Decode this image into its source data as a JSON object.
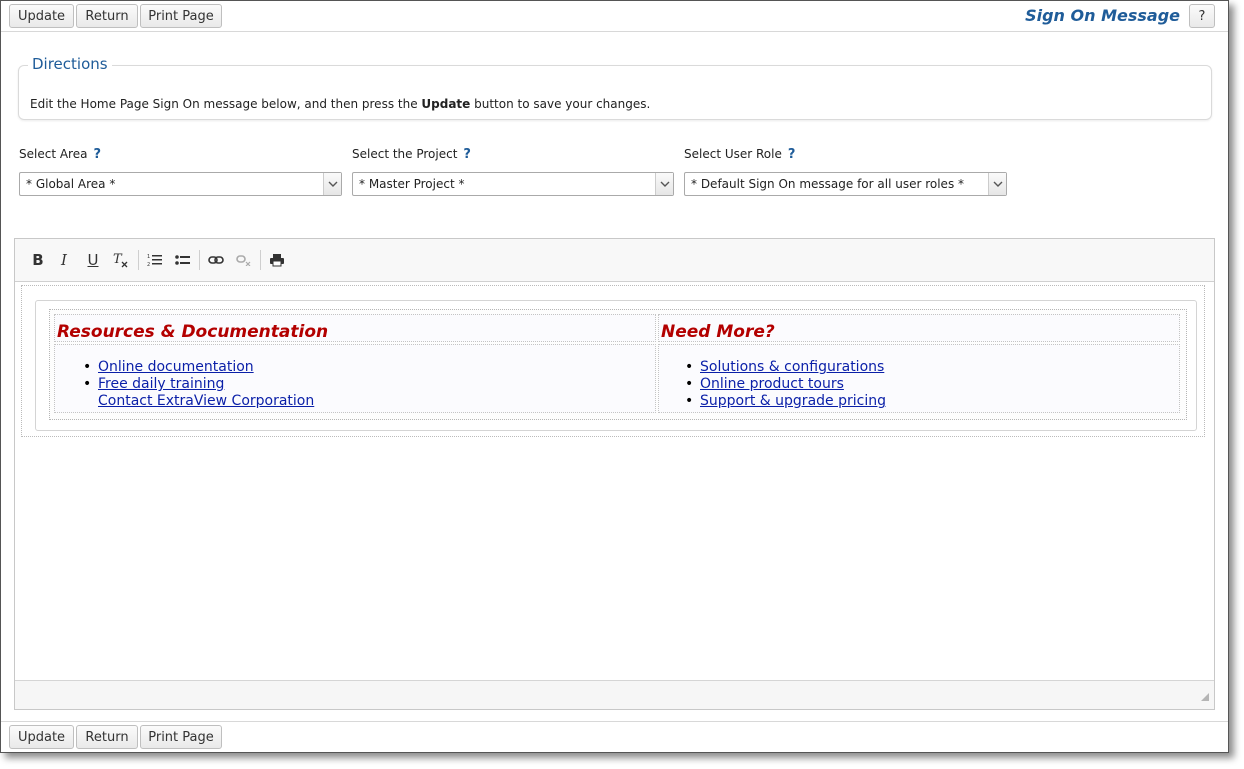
{
  "toolbar": {
    "update_label": "Update",
    "return_label": "Return",
    "print_label": "Print Page",
    "help_label": "?"
  },
  "header": {
    "title": "Sign On Message"
  },
  "directions": {
    "legend": "Directions",
    "text_before": "Edit the Home Page Sign On message below, and then press the ",
    "text_bold": "Update",
    "text_after": " button to save your changes."
  },
  "selectors": {
    "area": {
      "label": "Select Area",
      "value": "* Global Area *"
    },
    "project": {
      "label": "Select the Project",
      "value": "* Master Project *"
    },
    "role": {
      "label": "Select User Role",
      "value": "* Default Sign On message for all user roles *"
    },
    "help_mark": "?"
  },
  "editor": {
    "tools": [
      "bold-icon",
      "italic-icon",
      "underline-icon",
      "clear-format-icon",
      "numbered-list-icon",
      "bulleted-list-icon",
      "link-icon",
      "unlink-icon",
      "print-icon"
    ],
    "left_column": {
      "heading": "Resources & Documentation",
      "links": [
        "Online documentation",
        "Free daily training",
        "Contact ExtraView Corporation"
      ]
    },
    "right_column": {
      "heading": "Need More?",
      "links": [
        "Solutions & configurations",
        "Online product tours",
        "Support & upgrade pricing"
      ]
    }
  },
  "colors": {
    "accent_blue": "#1f5c99",
    "heading_red": "#b30000",
    "link_blue": "#0a1fa8"
  }
}
